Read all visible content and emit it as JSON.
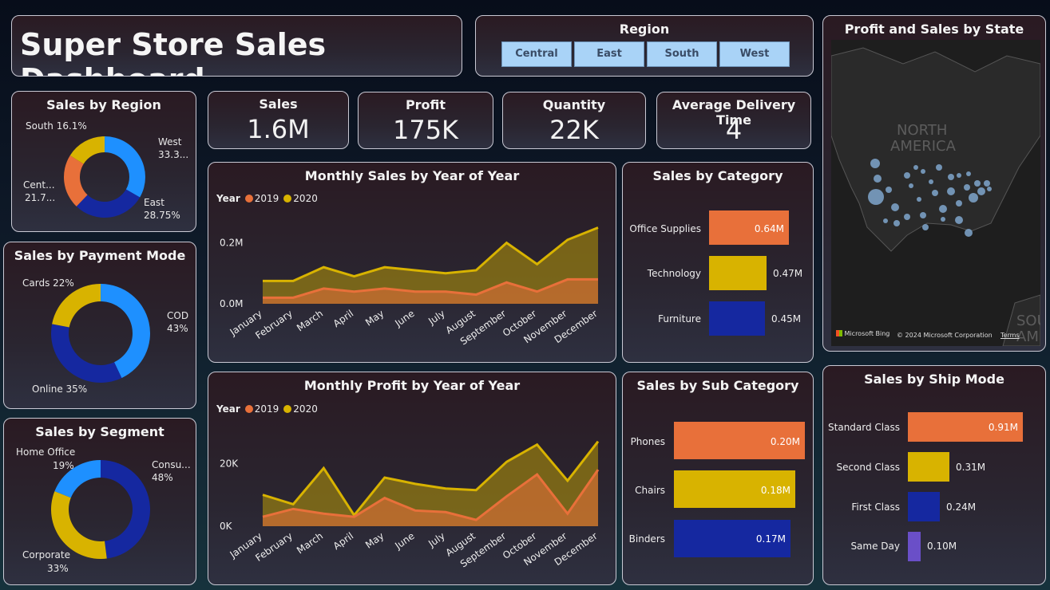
{
  "title": "Super Store Sales Dashboard",
  "region_slicer": {
    "title": "Region",
    "options": [
      "Central",
      "East",
      "South",
      "West"
    ]
  },
  "kpis": {
    "sales": {
      "label": "Sales",
      "value": "1.6M"
    },
    "profit": {
      "label": "Profit",
      "value": "175K"
    },
    "quantity": {
      "label": "Quantity",
      "value": "22K"
    },
    "delivery": {
      "label": "Average Delivery Time",
      "value": "4"
    }
  },
  "colors": {
    "orange": "#e8703a",
    "gold": "#d8b300",
    "navy": "#1528a0",
    "blue": "#1e90ff",
    "purple": "#6a4fc8",
    "map_dot": "#7fa6cc"
  },
  "sales_by_region": {
    "title": "Sales by Region",
    "labels": {
      "south": "South 16.1%",
      "west_name": "West",
      "west_value": "33.3...",
      "central_name": "Cent...",
      "central_value": "21.7...",
      "east_name": "East",
      "east_value": "28.75%"
    },
    "chart_data": {
      "type": "pie",
      "categories": [
        "West",
        "East",
        "Central",
        "South"
      ],
      "values": [
        33.3,
        28.75,
        21.7,
        16.1
      ],
      "colors": [
        "#1e90ff",
        "#1528a0",
        "#e8703a",
        "#d8b300"
      ]
    }
  },
  "sales_by_payment_mode": {
    "title": "Sales by Payment Mode",
    "labels": {
      "cards": "Cards 22%",
      "cod_name": "COD",
      "cod_value": "43%",
      "online": "Online 35%"
    },
    "chart_data": {
      "type": "pie",
      "categories": [
        "COD",
        "Online",
        "Cards"
      ],
      "values": [
        43,
        35,
        22
      ],
      "colors": [
        "#1e90ff",
        "#1528a0",
        "#d8b300"
      ]
    }
  },
  "sales_by_segment": {
    "title": "Sales by Segment",
    "labels": {
      "home_office_name": "Home Office",
      "home_office_value": "19%",
      "consumer_name": "Consu...",
      "consumer_value": "48%",
      "corporate_name": "Corporate",
      "corporate_value": "33%"
    },
    "chart_data": {
      "type": "pie",
      "categories": [
        "Consumer",
        "Corporate",
        "Home Office"
      ],
      "values": [
        48,
        33,
        19
      ],
      "colors": [
        "#1528a0",
        "#d8b300",
        "#1e90ff"
      ]
    }
  },
  "monthly_sales": {
    "title": "Monthly Sales by Year of Year",
    "legend_title": "Year",
    "chart_data": {
      "type": "area",
      "categories": [
        "January",
        "February",
        "March",
        "April",
        "May",
        "June",
        "July",
        "August",
        "September",
        "October",
        "November",
        "December"
      ],
      "series": [
        {
          "name": "2019",
          "values": [
            0.02,
            0.02,
            0.05,
            0.04,
            0.05,
            0.04,
            0.04,
            0.03,
            0.07,
            0.04,
            0.08,
            0.08
          ]
        },
        {
          "name": "2020",
          "values": [
            0.075,
            0.075,
            0.12,
            0.09,
            0.12,
            0.11,
            0.1,
            0.11,
            0.2,
            0.13,
            0.21,
            0.25
          ]
        }
      ],
      "yticks": [
        "0.0M",
        "0.2M"
      ],
      "ylim": [
        0,
        0.28
      ]
    }
  },
  "monthly_profit": {
    "title": "Monthly Profit by Year of Year",
    "legend_title": "Year",
    "chart_data": {
      "type": "area",
      "categories": [
        "January",
        "February",
        "March",
        "April",
        "May",
        "June",
        "July",
        "August",
        "September",
        "October",
        "November",
        "December"
      ],
      "series": [
        {
          "name": "2019",
          "values": [
            3000,
            5500,
            4000,
            3000,
            9000,
            5000,
            4500,
            2000,
            9500,
            16500,
            4000,
            18000
          ]
        },
        {
          "name": "2020",
          "values": [
            10000,
            7000,
            18500,
            3500,
            15500,
            13500,
            12000,
            11500,
            20500,
            26000,
            14500,
            27000
          ]
        }
      ],
      "yticks": [
        "0K",
        "20K"
      ],
      "ylim": [
        0,
        32000
      ]
    }
  },
  "sales_by_category": {
    "title": "Sales by Category",
    "chart_data": {
      "type": "bar",
      "categories": [
        "Office Supplies",
        "Technology",
        "Furniture"
      ],
      "values": [
        0.64,
        0.47,
        0.45
      ],
      "value_labels": [
        "0.64M",
        "0.47M",
        "0.45M"
      ],
      "colors": [
        "#e8703a",
        "#d8b300",
        "#1528a0"
      ]
    }
  },
  "sales_by_subcategory": {
    "title": "Sales by Sub Category",
    "chart_data": {
      "type": "bar",
      "categories": [
        "Phones",
        "Chairs",
        "Binders"
      ],
      "values": [
        0.2,
        0.18,
        0.17
      ],
      "value_labels": [
        "0.20M",
        "0.18M",
        "0.17M"
      ],
      "colors": [
        "#e8703a",
        "#d8b300",
        "#1528a0"
      ]
    }
  },
  "sales_by_ship_mode": {
    "title": "Sales by Ship Mode",
    "chart_data": {
      "type": "bar",
      "categories": [
        "Standard Class",
        "Second Class",
        "First Class",
        "Same Day"
      ],
      "values": [
        0.91,
        0.31,
        0.24,
        0.1
      ],
      "value_labels": [
        "0.91M",
        "0.31M",
        "0.24M",
        "0.10M"
      ],
      "colors": [
        "#e8703a",
        "#d8b300",
        "#1528a0",
        "#6a4fc8"
      ]
    }
  },
  "map": {
    "title": "Profit and Sales by State",
    "region_label_1": "NORTH",
    "region_label_2": "AMERICA",
    "region_label_3": "SOU",
    "region_label_4": "AME",
    "bing": "Microsoft Bing",
    "copyright": "© 2024 Microsoft Corporation",
    "terms": "Terms"
  }
}
